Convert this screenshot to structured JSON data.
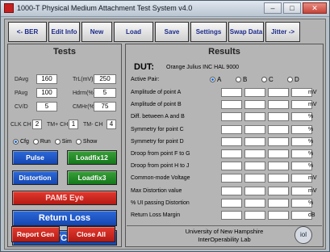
{
  "window": {
    "title": "1000-T Physical Medium Attachment Test System v4.0",
    "min": "–",
    "max": "□",
    "close": "✕"
  },
  "toolbar": [
    {
      "label": "<- BER",
      "w": 48
    },
    {
      "label": "Edit Info",
      "w": 39
    },
    {
      "label": "New",
      "w": 38
    },
    {
      "label": "Load",
      "w": 49
    },
    {
      "label": "Save",
      "w": 42
    },
    {
      "label": "Settings",
      "w": 45
    },
    {
      "label": "Swap Data",
      "w": 44
    },
    {
      "label": "Jitter ->",
      "w": 43
    }
  ],
  "tests": {
    "title": "Tests",
    "params": [
      {
        "label": "DAvg",
        "value": "160"
      },
      {
        "label": "TrL(mV)",
        "value": "250"
      },
      {
        "label": "PAvg",
        "value": "100"
      },
      {
        "label": "Hdrm(%)",
        "value": "5"
      },
      {
        "label": "CV/D",
        "value": "5"
      },
      {
        "label": "CMHr(%)",
        "value": "75"
      }
    ],
    "channels": [
      {
        "label": "CLK CH",
        "value": "2"
      },
      {
        "label": "TM+ CH",
        "value": "1"
      },
      {
        "label": "TM- CH",
        "value": "4"
      }
    ],
    "modes": [
      {
        "label": "Cfg",
        "selected": true
      },
      {
        "label": "Run",
        "selected": false
      },
      {
        "label": "Sim",
        "selected": false
      },
      {
        "label": "Show",
        "selected": false
      }
    ],
    "buttons": {
      "pulse": "Pulse",
      "loadfix12": "Loadfix12",
      "distortion": "Distortion",
      "loadfix3": "Loadfix3",
      "pam5_eye": "PAM5 Eye",
      "return_loss": "Return Loss",
      "vcm": "VCM",
      "report_gen": "Report Gen",
      "close_all": "Close All"
    }
  },
  "results": {
    "title": "Results",
    "dut_label": "DUT:",
    "dut_value": "Orange Julius INC HAL 9000",
    "active_pair_label": "Active Pair:",
    "pairs": [
      {
        "label": "A",
        "selected": true
      },
      {
        "label": "B",
        "selected": false
      },
      {
        "label": "C",
        "selected": false
      },
      {
        "label": "D",
        "selected": false
      }
    ],
    "rows": [
      {
        "label": "Amplitude of point A",
        "unit": "mV"
      },
      {
        "label": "Amplitude of point B",
        "unit": "mV"
      },
      {
        "label": "Diff. between A and B",
        "unit": "%"
      },
      {
        "label": "Symmetry for point C",
        "unit": "%"
      },
      {
        "label": "Symmetry for point D",
        "unit": "%"
      },
      {
        "label": "Droop from point F to G",
        "unit": "%"
      },
      {
        "label": "Droop from point H to J",
        "unit": "%"
      },
      {
        "label": "Common-mode Voltage",
        "unit": "mV"
      },
      {
        "label": "Max Distortion value",
        "unit": "mV"
      },
      {
        "label": "% UI passing Distortion",
        "unit": "%"
      },
      {
        "label": "Return Loss Margin",
        "unit": "dB"
      }
    ],
    "footer_line1": "University of New Hampshire",
    "footer_line2": "InterOperability Lab",
    "logo_text": "iol"
  }
}
